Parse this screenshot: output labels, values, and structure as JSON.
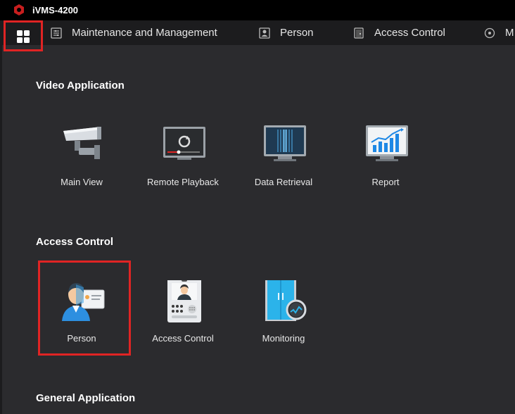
{
  "window": {
    "title": "iVMS-4200"
  },
  "tabs": [
    {
      "label": "Maintenance and Management",
      "icon": "maintenance-icon"
    },
    {
      "label": "Person",
      "icon": "person-card-icon"
    },
    {
      "label": "Access Control",
      "icon": "door-icon"
    },
    {
      "label": "M",
      "icon": "compass-icon"
    }
  ],
  "sections": {
    "video": {
      "title": "Video Application",
      "apps": [
        {
          "label": "Main View",
          "icon": "camera-icon"
        },
        {
          "label": "Remote Playback",
          "icon": "playback-icon"
        },
        {
          "label": "Data Retrieval",
          "icon": "data-retrieval-icon"
        },
        {
          "label": "Report",
          "icon": "report-chart-icon"
        }
      ]
    },
    "access": {
      "title": "Access Control",
      "apps": [
        {
          "label": "Person",
          "icon": "person-icon"
        },
        {
          "label": "Access Control",
          "icon": "intercom-icon"
        },
        {
          "label": "Monitoring",
          "icon": "monitoring-icon"
        }
      ]
    },
    "general": {
      "title": "General Application"
    }
  },
  "colors": {
    "highlight": "#e02424",
    "background": "#2b2b2e",
    "tabbar": "#1c1c1e"
  }
}
